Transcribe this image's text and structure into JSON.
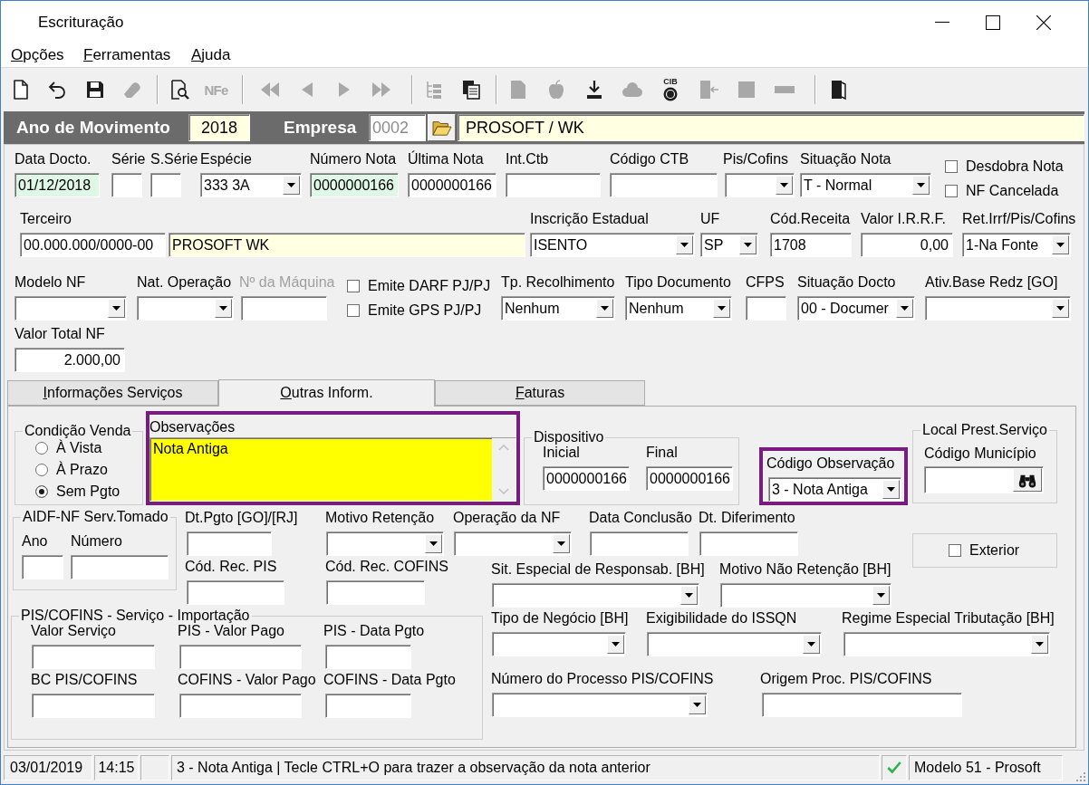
{
  "window": {
    "title": "Escrituração"
  },
  "menu": [
    {
      "label": "Opções"
    },
    {
      "label": "Ferramentas"
    },
    {
      "label": "Ajuda"
    }
  ],
  "toolbar": [
    [
      {
        "disabled": false
      },
      {
        "disabled": false
      },
      {
        "disabled": false
      },
      {
        "disabled": true
      }
    ],
    [
      {
        "disabled": false
      },
      {
        "disabled": true,
        "label": "NFe"
      }
    ],
    [
      {
        "disabled": true
      },
      {
        "disabled": true
      },
      {
        "disabled": true
      },
      {
        "disabled": true
      }
    ],
    [
      {
        "disabled": true
      },
      {
        "disabled": false
      }
    ],
    [
      {
        "disabled": true
      },
      {
        "disabled": true
      },
      {
        "disabled": false
      },
      {
        "disabled": true
      },
      {
        "disabled": false,
        "label": "CIB"
      },
      {
        "disabled": true
      },
      {
        "disabled": true
      },
      {
        "disabled": true
      }
    ],
    [
      {
        "disabled": false
      }
    ]
  ],
  "header": {
    "year_label": "Ano de Movimento",
    "year": "2018",
    "company_label": "Empresa",
    "company_code": {
      "value": "0002",
      "disabled": true
    },
    "company_name": "PROSOFT / WK"
  },
  "form": {
    "lines": [
      {
        "fields": [
          {
            "kind": "text",
            "label": "Data Docto.",
            "value": "01/12/2018",
            "color": "#dff7e5",
            "disabled": false
          },
          {
            "kind": "text",
            "label": "Série",
            "disabled": false
          },
          {
            "kind": "text",
            "label": "S.Série",
            "disabled": false
          },
          {
            "kind": "combo",
            "label": "Espécie",
            "value": "333 3A",
            "disabled": false
          },
          {
            "kind": "text",
            "label": "Número Nota",
            "value": "0000000166",
            "color": "#dff7e5",
            "disabled": false
          },
          {
            "kind": "text",
            "label": "Última Nota",
            "value": "0000000166",
            "disabled": false
          },
          {
            "kind": "text",
            "label": "Int.Ctb",
            "disabled": false
          },
          {
            "kind": "text",
            "label": "Código CTB",
            "disabled": false
          },
          {
            "kind": "combo",
            "label": "Pis/Cofins",
            "disabled": false
          },
          {
            "kind": "combo",
            "label": "Situação Nota",
            "value": "T - Normal",
            "disabled": false
          },
          {
            "kind": "checks",
            "disabled": false,
            "items": [
              {
                "label": "Desdobra Nota",
                "checked": false
              },
              {
                "label": "NF Cancelada",
                "checked": false
              }
            ]
          }
        ]
      },
      {
        "fields": [
          {
            "kind": "text",
            "label": "Terceiro",
            "value": "00.000.000/0000-00",
            "disabled": false
          },
          {
            "kind": "text",
            "value": "PROSOFT WK",
            "color": "#ffffe1",
            "disabled": false
          },
          {
            "kind": "combo",
            "label": "Inscrição Estadual",
            "value": "ISENTO",
            "disabled": false
          },
          {
            "kind": "combo",
            "label": "UF",
            "value": "SP",
            "disabled": false
          },
          {
            "kind": "text",
            "label": "Cód.Receita",
            "value": "1708",
            "disabled": false
          },
          {
            "kind": "number",
            "label": "Valor I.R.R.F.",
            "value": "0,00",
            "disabled": false
          },
          {
            "kind": "combo",
            "label": "Ret.Irrf/Pis/Cofins",
            "value": "1-Na Fonte",
            "disabled": false
          }
        ]
      },
      {
        "fields": [
          {
            "kind": "combo",
            "label": "Modelo NF",
            "disabled": false
          },
          {
            "kind": "combo",
            "label": "Nat. Operação",
            "disabled": false
          },
          {
            "kind": "text",
            "label": "Nº da Máquina",
            "disabled": true
          },
          {
            "kind": "checks",
            "disabled": false,
            "items": [
              {
                "label": "Emite DARF PJ/PJ",
                "checked": false
              },
              {
                "label": "Emite GPS PJ/PJ",
                "checked": false
              }
            ]
          },
          {
            "kind": "combo",
            "label": "Tp. Recolhimento",
            "value": "Nenhum",
            "disabled": false
          },
          {
            "kind": "combo",
            "label": "Tipo Documento",
            "value": "Nenhum",
            "disabled": false
          },
          {
            "kind": "text",
            "label": "CFPS",
            "disabled": false
          },
          {
            "kind": "combo",
            "label": "Situação Docto",
            "value": "00 - Documer",
            "disabled": false
          },
          {
            "kind": "combo",
            "label": "Ativ.Base Redz [GO]",
            "disabled": false
          }
        ]
      },
      {
        "fields": [
          {
            "kind": "number",
            "label": "Valor Total NF",
            "value": "2.000,00",
            "disabled": false
          }
        ]
      }
    ]
  },
  "tabs": [
    {
      "label": "Informações Serviços",
      "selected": false
    },
    {
      "label": "Outras Inform.",
      "selected": true
    },
    {
      "label": "Faturas",
      "selected": false
    }
  ],
  "tab_panel": {
    "sale_condition": {
      "title": "Condição Venda",
      "options": [
        {
          "label": "À Vista",
          "selected": false
        },
        {
          "label": "À Prazo",
          "selected": false
        },
        {
          "label": "Sem Pgto",
          "selected": true
        }
      ]
    },
    "observations": {
      "label": "Observações",
      "value": "Nota Antiga",
      "color": "#ffff00",
      "highlighted": true
    },
    "device": {
      "title": "Dispositivo",
      "fields": [
        {
          "label": "Inicial",
          "value": "0000000166"
        },
        {
          "label": "Final",
          "value": "0000000166"
        }
      ]
    },
    "observation_code": {
      "label": "Código Observação",
      "value": "3 - Nota Antiga",
      "highlighted": true
    },
    "service_location": {
      "title": "Local Prest.Serviço",
      "label": "Código Município"
    },
    "aidf": {
      "title": "AIDF-NF Serv.Tomado",
      "fields": [
        {
          "label": "Ano"
        },
        {
          "label": "Número"
        }
      ]
    },
    "middle_lines": [
      {
        "fields": [
          {
            "kind": "text",
            "label": "Dt.Pgto [GO]/[RJ]"
          },
          {
            "kind": "combo",
            "label": "Motivo Retenção"
          },
          {
            "kind": "combo",
            "label": "Operação da NF"
          },
          {
            "kind": "text",
            "label": "Data Conclusão"
          },
          {
            "kind": "text",
            "label": "Dt. Diferimento"
          }
        ]
      },
      {
        "fields": [
          {
            "kind": "text",
            "label": "Cód. Rec. PIS"
          },
          {
            "kind": "text",
            "label": "Cód. Rec. COFINS"
          },
          {
            "kind": "combo",
            "label": "Sit. Especial de Responsab. [BH]"
          },
          {
            "kind": "combo",
            "label": "Motivo Não Retenção [BH]"
          }
        ]
      }
    ],
    "exterior": {
      "label": "Exterior",
      "checked": false
    },
    "pis_cofins_import": {
      "title": "PIS/COFINS - Serviço - Importação",
      "fields": [
        {
          "label": "Valor Serviço"
        },
        {
          "label": "PIS - Valor Pago"
        },
        {
          "label": "PIS - Data Pgto"
        },
        {
          "label": "BC PIS/COFINS"
        },
        {
          "label": "COFINS - Valor Pago"
        },
        {
          "label": "COFINS - Data Pgto"
        }
      ]
    },
    "bh_lines": [
      {
        "fields": [
          {
            "kind": "combo",
            "label": "Tipo de Negócio [BH]"
          },
          {
            "kind": "combo",
            "label": "Exigibilidade do ISSQN"
          },
          {
            "kind": "combo",
            "label": "Regime Especial Tributação [BH]"
          }
        ]
      },
      {
        "fields": [
          {
            "kind": "combo",
            "label": "Número do Processo PIS/COFINS"
          },
          {
            "kind": "text",
            "label": "Origem Proc. PIS/COFINS"
          }
        ]
      }
    ]
  },
  "status_bar": {
    "date": "03/01/2019",
    "time": "14:15",
    "message": "3 - Nota Antiga | Tecle CTRL+O para trazer a observação da nota anterior",
    "ok": true,
    "model": "Modelo 51 - Prosoft"
  }
}
